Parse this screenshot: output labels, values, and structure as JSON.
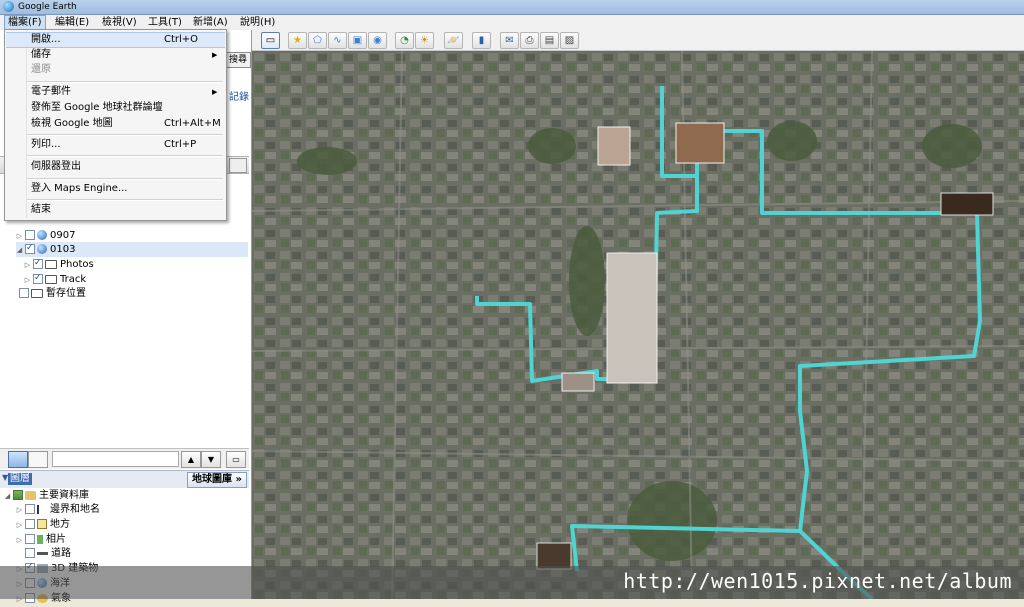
{
  "window": {
    "title": "Google Earth"
  },
  "menubar": {
    "items": [
      "檔案(F)",
      "編輯(E)",
      "檢視(V)",
      "工具(T)",
      "新增(A)",
      "說明(H)"
    ]
  },
  "file_menu": {
    "open": {
      "label": "開啟...",
      "shortcut": "Ctrl+O"
    },
    "save": {
      "label": "儲存"
    },
    "revert": {
      "label": "還原"
    },
    "email": {
      "label": "電子郵件"
    },
    "publish": {
      "label": "發佈至 Google 地球社群論壇"
    },
    "view_maps": {
      "label": "檢視 Google 地圖",
      "shortcut": "Ctrl+Alt+M"
    },
    "print": {
      "label": "列印...",
      "shortcut": "Ctrl+P"
    },
    "logout": {
      "label": "伺服器登出"
    },
    "maps_engine": {
      "label": "登入 Maps Engine..."
    },
    "exit": {
      "label": "結束"
    }
  },
  "search_panel": {
    "search_button": "搜尋",
    "record_link": "記錄"
  },
  "places": [
    {
      "label": "0907",
      "checked": false
    },
    {
      "label": "0103",
      "checked": true
    },
    {
      "label": "Photos",
      "checked": true
    },
    {
      "label": "Track",
      "checked": true
    },
    {
      "label": "暫存位置",
      "checked": false
    }
  ],
  "layers": {
    "header": "圖層",
    "gallery_button": "地球圖庫 »",
    "items": [
      "主要資料庫",
      "邊界和地名",
      "地方",
      "相片",
      "道路",
      "3D 建築物",
      "海洋",
      "氣象"
    ]
  },
  "watermark": {
    "text": "http://wen1015.pixnet.net/album"
  },
  "colors": {
    "track": "#4fd3d3",
    "menu_highlight": "#dde9f8"
  }
}
